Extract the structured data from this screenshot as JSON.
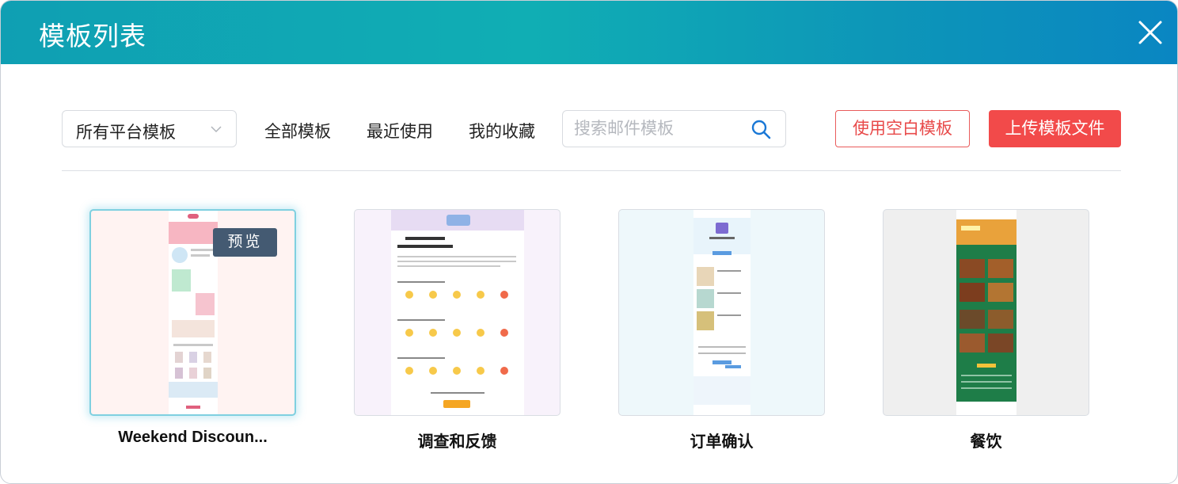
{
  "dialog": {
    "title": "模板列表"
  },
  "toolbar": {
    "platform_select": "所有平台模板",
    "tabs": [
      "全部模板",
      "最近使用",
      "我的收藏"
    ],
    "search_placeholder": "搜索邮件模板",
    "blank_button": "使用空白模板",
    "upload_button": "上传模板文件"
  },
  "templates": [
    {
      "name": "Weekend Discoun...",
      "preview_label": "预览"
    },
    {
      "name": "调查和反馈"
    },
    {
      "name": "订单确认"
    },
    {
      "name": "餐饮"
    }
  ],
  "colors": {
    "header_start": "#0f9fb3",
    "header_end": "#0a86c2",
    "accent_red": "#f24a4a",
    "select_glow": "#7fd0e0"
  },
  "icons": {
    "close": "close-icon",
    "chevron": "chevron-down-icon",
    "search": "search-icon"
  }
}
